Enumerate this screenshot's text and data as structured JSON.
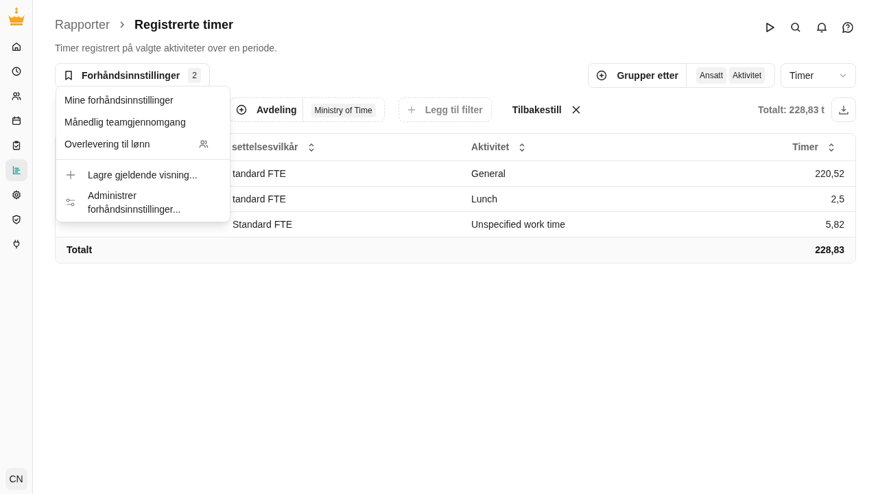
{
  "sidebar": {
    "items": [
      {
        "kind": "home",
        "selected": false
      },
      {
        "kind": "clock",
        "selected": false
      },
      {
        "kind": "users",
        "selected": false
      },
      {
        "kind": "calendar",
        "selected": false
      },
      {
        "kind": "clipboard",
        "selected": false
      },
      {
        "kind": "report",
        "selected": true
      },
      {
        "kind": "settings",
        "selected": false
      },
      {
        "kind": "shield",
        "selected": false
      },
      {
        "kind": "plug",
        "selected": false
      }
    ],
    "avatar": "CN"
  },
  "breadcrumb": {
    "parent": "Rapporter",
    "current": "Registrerte timer"
  },
  "subtitle": "Timer registrert på valgte aktiviteter over en periode.",
  "presets_button": {
    "label": "Forhåndsinnstillinger",
    "count": "2"
  },
  "presets_menu": {
    "items": [
      {
        "label": "Mine forhåndsinnstillinger",
        "shared": false
      },
      {
        "label": "Månedlig teamgjennomgang",
        "shared": false
      },
      {
        "label": "Overlevering til lønn",
        "shared": true
      }
    ],
    "actions": [
      {
        "kind": "add",
        "label": "Lagre gjeldende visning..."
      },
      {
        "kind": "manage",
        "label": "Administrer forhåndsinnstillinger..."
      }
    ]
  },
  "group_by": {
    "label": "Grupper etter",
    "chips": [
      "Ansatt",
      "Aktivitet"
    ]
  },
  "metric_select": {
    "value": "Timer"
  },
  "filters": [
    {
      "label": "Avdeling",
      "value": "Ministry of Time"
    }
  ],
  "add_filter": "Legg til filter",
  "reset": "Tilbakestill",
  "total": "Totalt: 228,83 t",
  "table": {
    "columns": [
      {
        "label": "settelsesvilkår"
      },
      {
        "label": "Aktivitet"
      },
      {
        "label": "Timer"
      }
    ],
    "rows": [
      [
        "tandard FTE",
        "General",
        "220,52"
      ],
      [
        "tandard FTE",
        "Lunch",
        "2,5"
      ],
      [
        "Standard FTE",
        "Unspecified work time",
        "5,82"
      ]
    ],
    "footer": {
      "label": "Totalt",
      "value": "228,83"
    }
  }
}
